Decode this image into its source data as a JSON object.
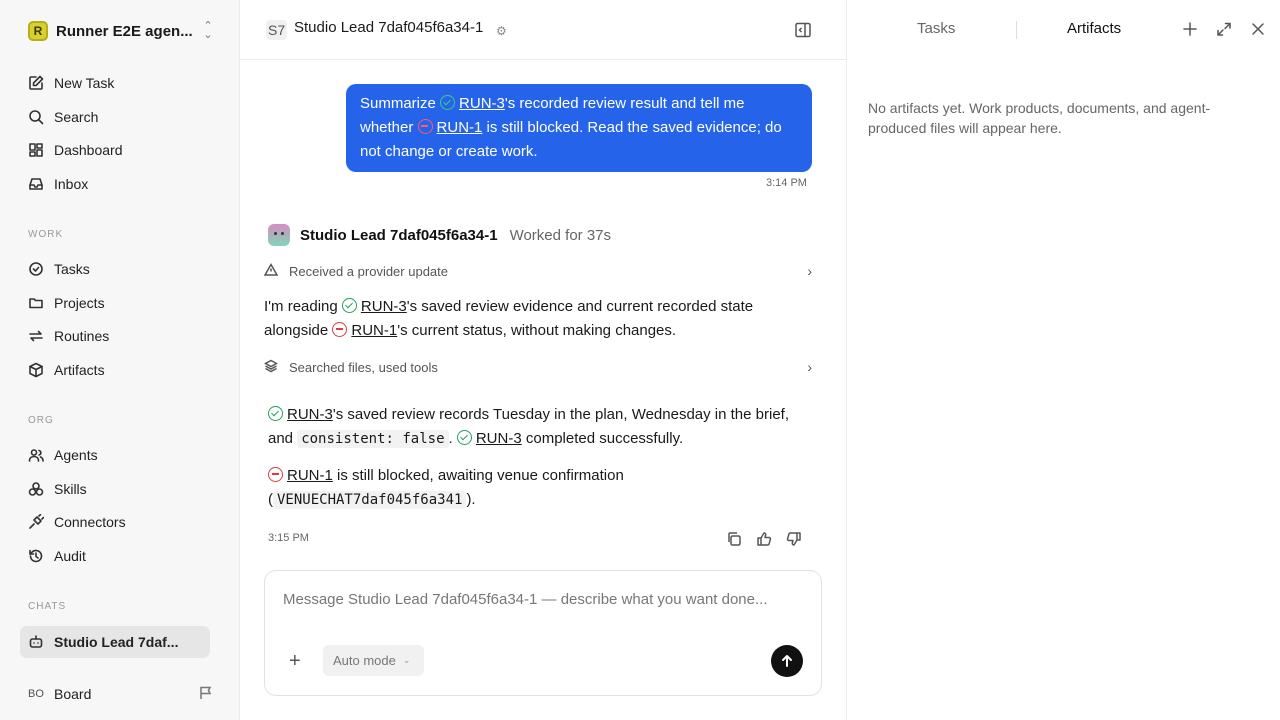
{
  "workspace": {
    "logo_letter": "R",
    "name": "Runner E2E agen..."
  },
  "nav": {
    "new_task": "New Task",
    "search": "Search",
    "dashboard": "Dashboard",
    "inbox": "Inbox"
  },
  "sections": {
    "work": "WORK",
    "org": "ORG",
    "chats": "CHATS"
  },
  "work_items": {
    "tasks": "Tasks",
    "projects": "Projects",
    "routines": "Routines",
    "artifacts": "Artifacts"
  },
  "org_items": {
    "agents": "Agents",
    "skills": "Skills",
    "connectors": "Connectors",
    "audit": "Audit"
  },
  "chat_item": "Studio Lead 7daf...",
  "board": {
    "avatar": "BO",
    "label": "Board"
  },
  "topbar": {
    "badge": "S7",
    "title": "Studio Lead 7daf045f6a34-1"
  },
  "user_message": {
    "p1": "Summarize ",
    "run3": "RUN-3",
    "p2": "'s recorded review result and tell me whether ",
    "run1": "RUN-1",
    "p3": " is still blocked. Read the saved evidence; do not change or create work.",
    "time": "3:14 PM"
  },
  "agent": {
    "name": "Studio Lead 7daf045f6a34-1",
    "worked": "Worked for 37s"
  },
  "steps": {
    "provider_update": "Received a provider update",
    "searched": "Searched files, used tools"
  },
  "para1": {
    "a": "I'm reading ",
    "run3": "RUN-3",
    "b": "'s saved review evidence and current recorded state alongside ",
    "run1": "RUN-1",
    "c": "'s current status, without making changes."
  },
  "para2": {
    "run3a": "RUN-3",
    "a": "'s saved review records Tuesday in the plan, Wednesday in the brief, and ",
    "code": "consistent: false",
    "b": ". ",
    "run3b": "RUN-3",
    "c": " completed successfully."
  },
  "para3": {
    "run1": "RUN-1",
    "a": " is still blocked, awaiting venue confirmation (",
    "code": "VENUECHAT7daf045f6a341",
    "b": ")."
  },
  "agent_time": "3:15 PM",
  "composer": {
    "placeholder": "Message Studio Lead 7daf045f6a34-1 — describe what you want done...",
    "mode": "Auto mode"
  },
  "right_panel": {
    "tab_tasks": "Tasks",
    "tab_artifacts": "Artifacts",
    "empty": "No artifacts yet. Work products, documents, and agent-produced files will appear here."
  },
  "colors": {
    "accent": "#2563eb",
    "success": "#22a05a",
    "blocked": "#e0393e"
  }
}
